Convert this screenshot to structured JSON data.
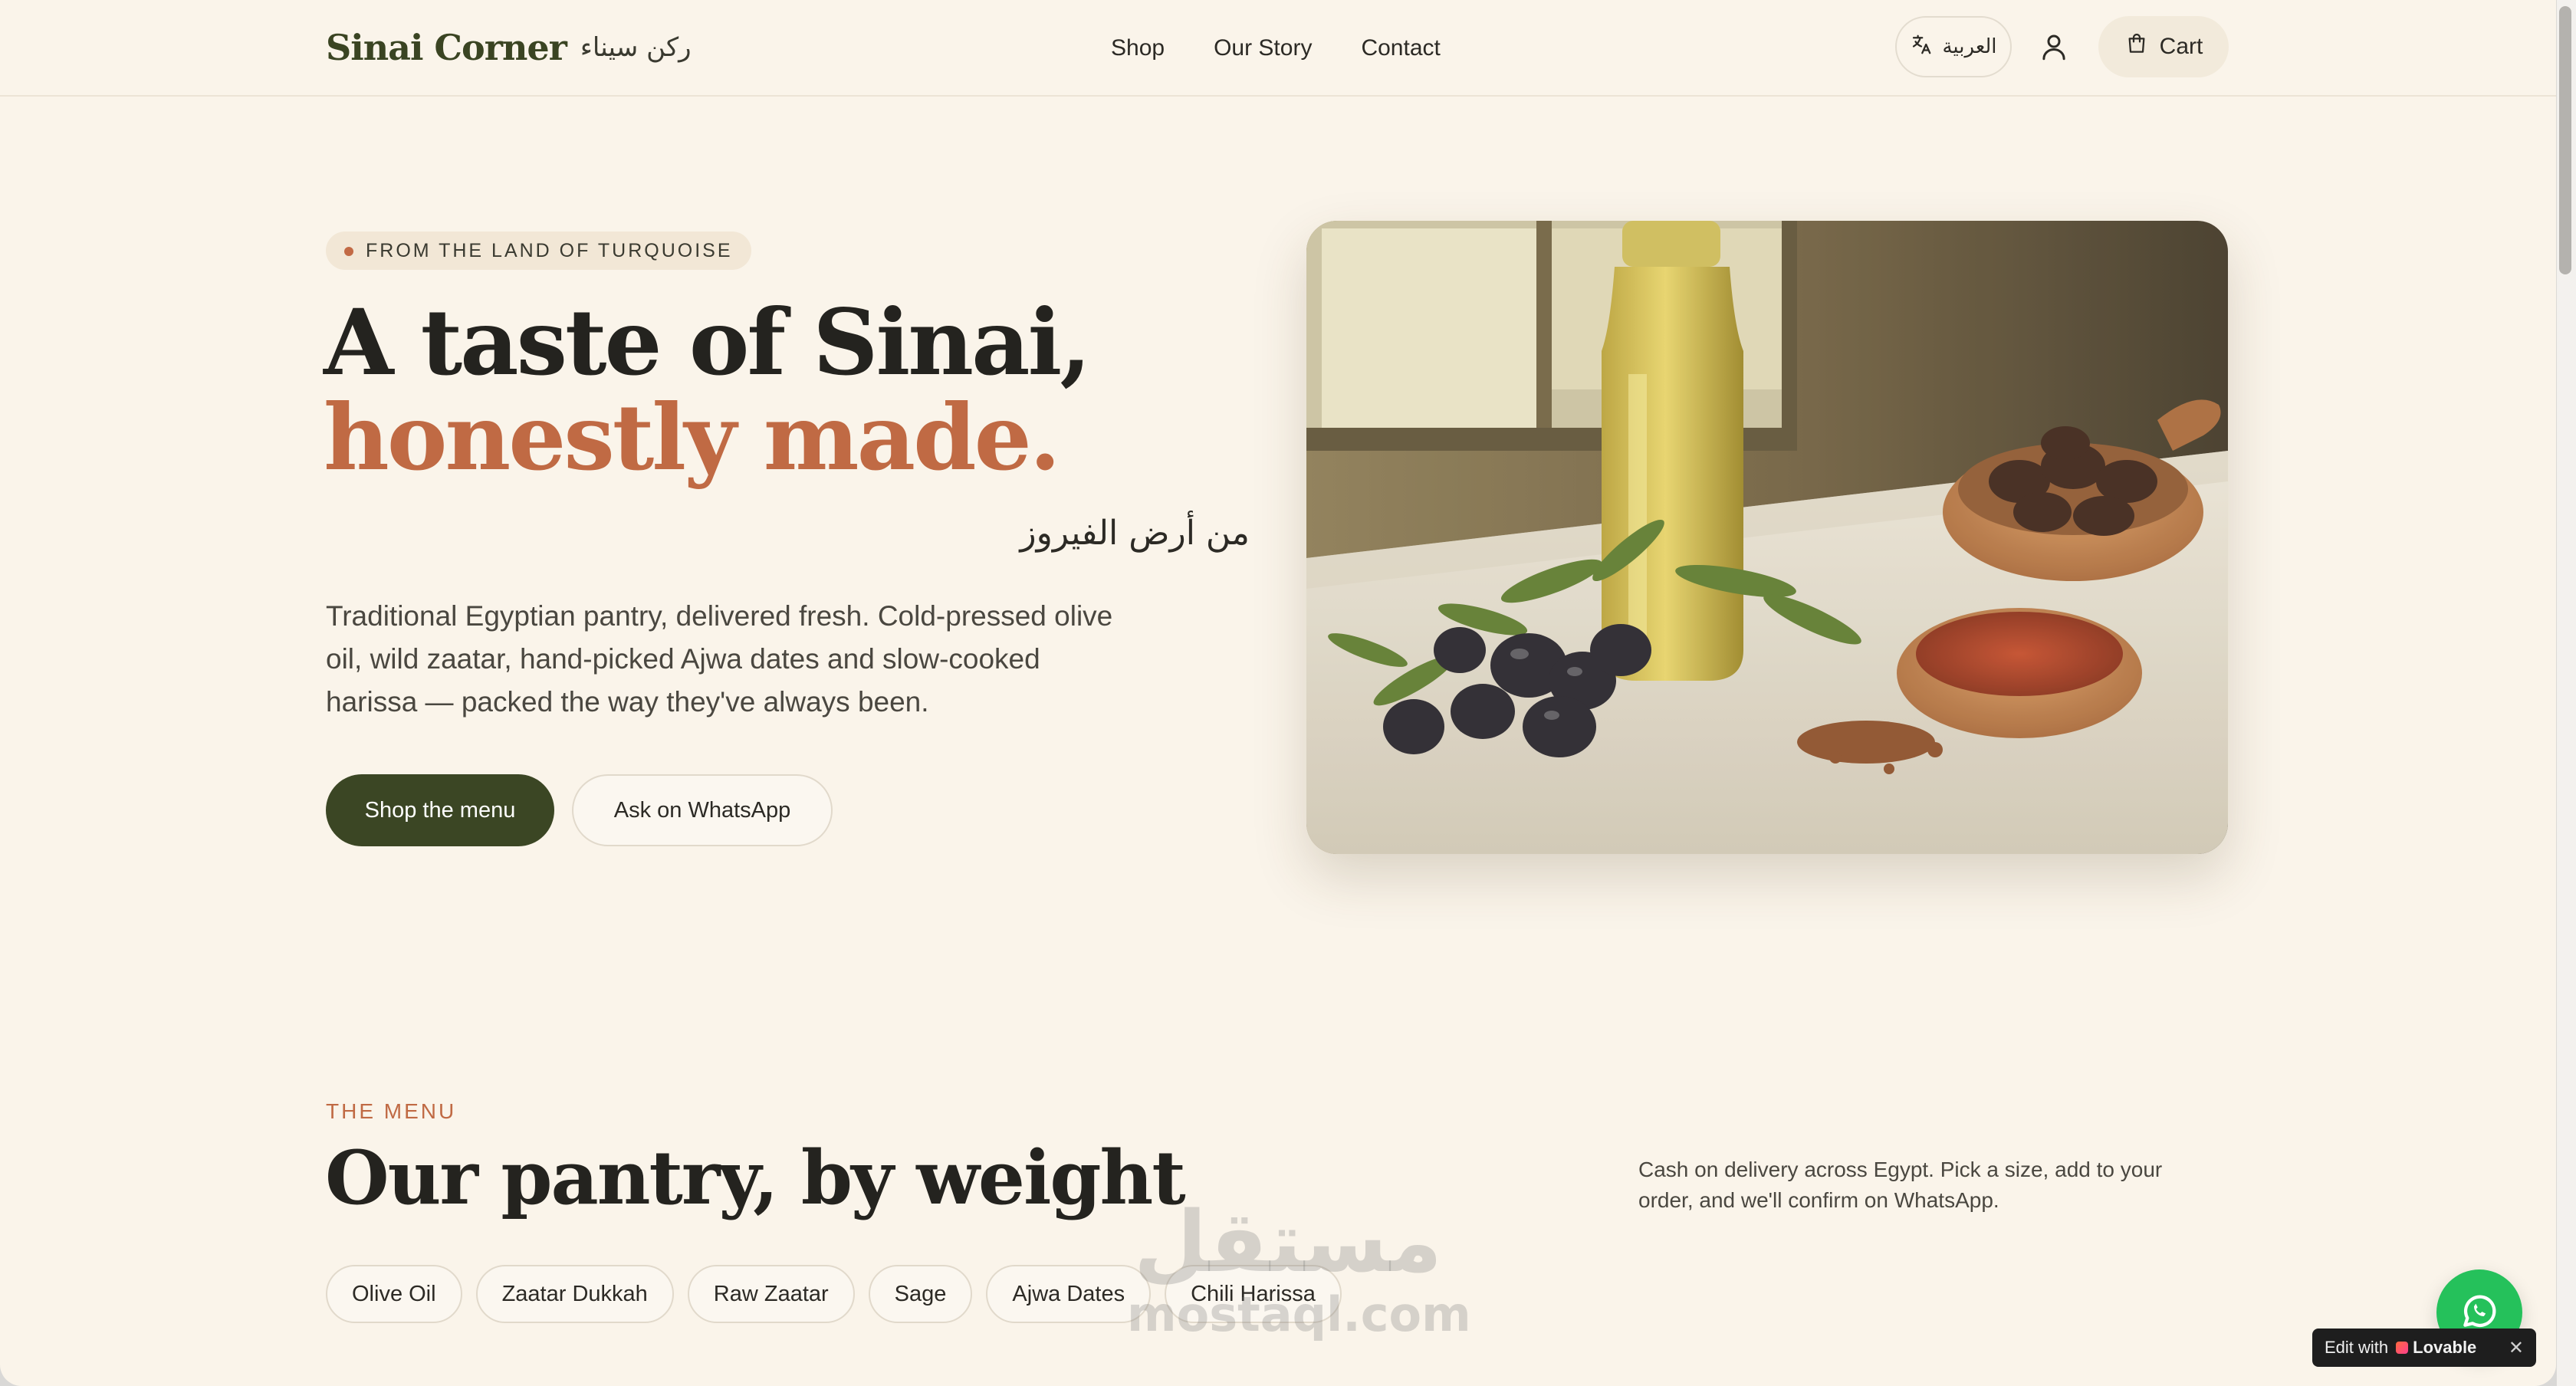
{
  "header": {
    "brand_name": "Sinai Corner",
    "brand_arabic": "ركن سيناء",
    "nav": [
      "Shop",
      "Our Story",
      "Contact"
    ],
    "language_label": "العربية",
    "cart_label": "Cart"
  },
  "hero": {
    "eyebrow": "FROM THE LAND OF TURQUOISE",
    "headline_line1": "A taste of Sinai,",
    "headline_line2": "honestly made.",
    "arabic_tagline": "من أرض الفيروز",
    "description": "Traditional Egyptian pantry, delivered fresh. Cold-pressed olive oil, wild zaatar, hand-picked Ajwa dates and slow-cooked harissa — packed the way they've always been.",
    "primary_cta": "Shop the menu",
    "secondary_cta": "Ask on WhatsApp"
  },
  "menu": {
    "eyebrow": "THE MENU",
    "title": "Our pantry, by weight",
    "note": "Cash on delivery across Egypt. Pick a size, add to your order, and we'll confirm on WhatsApp.",
    "categories": [
      "Olive Oil",
      "Zaatar Dukkah",
      "Raw Zaatar",
      "Sage",
      "Ajwa Dates",
      "Chili Harissa"
    ]
  },
  "watermark": {
    "arabic": "مستقل",
    "latin": "mostaql.com"
  },
  "badge": {
    "edit_label": "Edit with",
    "brand": "Lovable",
    "close": "✕"
  },
  "colors": {
    "page_bg": "#faf4ea",
    "brand_green": "#3b4624",
    "accent_terracotta": "#c06a44",
    "whatsapp_green": "#25c15b"
  },
  "icons": {
    "language": "translate-icon",
    "account": "user-icon",
    "cart": "shopping-bag-icon",
    "chat": "whatsapp-icon"
  }
}
